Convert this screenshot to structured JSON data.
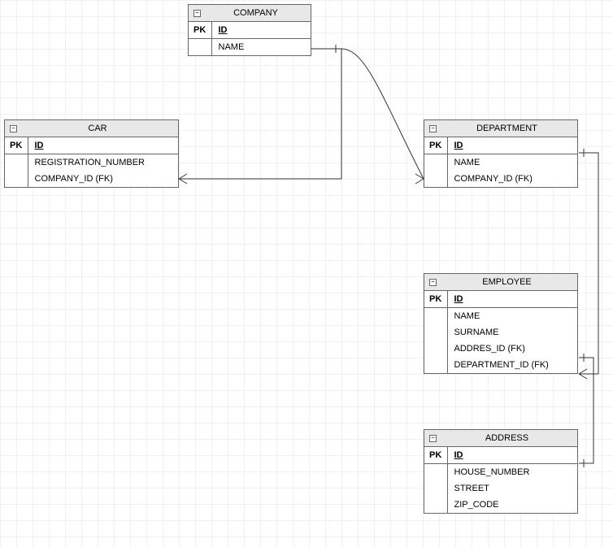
{
  "entities": {
    "company": {
      "title": "COMPANY",
      "pk_label": "PK",
      "pk_field": "ID",
      "fields": [
        "NAME"
      ]
    },
    "car": {
      "title": "CAR",
      "pk_label": "PK",
      "pk_field": "ID",
      "fields": [
        "REGISTRATION_NUMBER",
        "COMPANY_ID (FK)"
      ]
    },
    "department": {
      "title": "DEPARTMENT",
      "pk_label": "PK",
      "pk_field": "ID",
      "fields": [
        "NAME",
        "COMPANY_ID (FK)"
      ]
    },
    "employee": {
      "title": "EMPLOYEE",
      "pk_label": "PK",
      "pk_field": "ID",
      "fields": [
        "NAME",
        "SURNAME",
        "ADDRES_ID (FK)",
        "DEPARTMENT_ID (FK)"
      ]
    },
    "address": {
      "title": "ADDRESS",
      "pk_label": "PK",
      "pk_field": "ID",
      "fields": [
        "HOUSE_NUMBER",
        "STREET",
        "ZIP_CODE"
      ]
    }
  }
}
